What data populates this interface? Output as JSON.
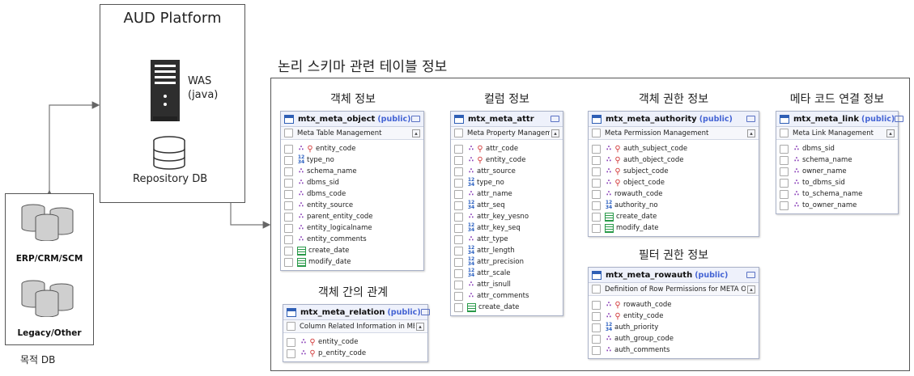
{
  "aud_platform": {
    "title": "AUD Platform",
    "was_label": "WAS\n(java)",
    "repository_label": "Repository DB"
  },
  "target_db": {
    "erp_label": "ERP/CRM/SCM",
    "legacy_label": "Legacy/Other",
    "caption": "목적 DB"
  },
  "main_title": "논리 스키마 관련 테이블 정보",
  "sections": {
    "object": "객체 정보",
    "column": "컬럼 정보",
    "authority": "객체 권한 정보",
    "link": "메타 코드 연결 정보",
    "relation": "객체 간의 관계",
    "filter": "필터 권한 정보"
  },
  "tables": {
    "object": {
      "name": "mtx_meta_object",
      "schema": "(public)",
      "comment": "Meta Table Management",
      "columns": [
        {
          "name": "entity_code",
          "icons": [
            "rel",
            "key"
          ]
        },
        {
          "name": "type_no",
          "icons": [
            "num"
          ]
        },
        {
          "name": "schema_name",
          "icons": [
            "rel"
          ]
        },
        {
          "name": "dbms_sid",
          "icons": [
            "rel"
          ]
        },
        {
          "name": "dbms_code",
          "icons": [
            "rel"
          ]
        },
        {
          "name": "entity_source",
          "icons": [
            "rel"
          ]
        },
        {
          "name": "parent_entity_code",
          "icons": [
            "rel"
          ]
        },
        {
          "name": "entity_logicalname",
          "icons": [
            "rel"
          ]
        },
        {
          "name": "entity_comments",
          "icons": [
            "rel"
          ]
        },
        {
          "name": "create_date",
          "icons": [
            "date"
          ]
        },
        {
          "name": "modify_date",
          "icons": [
            "date"
          ]
        }
      ]
    },
    "attr": {
      "name": "mtx_meta_attr",
      "schema": "",
      "comment": "Meta Property Managemen",
      "columns": [
        {
          "name": "attr_code",
          "icons": [
            "rel",
            "key"
          ]
        },
        {
          "name": "entity_code",
          "icons": [
            "rel",
            "key"
          ]
        },
        {
          "name": "attr_source",
          "icons": [
            "rel"
          ]
        },
        {
          "name": "type_no",
          "icons": [
            "num"
          ]
        },
        {
          "name": "attr_name",
          "icons": [
            "rel"
          ]
        },
        {
          "name": "attr_seq",
          "icons": [
            "num"
          ]
        },
        {
          "name": "attr_key_yesno",
          "icons": [
            "rel"
          ]
        },
        {
          "name": "attr_key_seq",
          "icons": [
            "num"
          ]
        },
        {
          "name": "attr_type",
          "icons": [
            "rel"
          ]
        },
        {
          "name": "attr_length",
          "icons": [
            "num"
          ]
        },
        {
          "name": "attr_precision",
          "icons": [
            "num"
          ]
        },
        {
          "name": "attr_scale",
          "icons": [
            "num"
          ]
        },
        {
          "name": "attr_isnull",
          "icons": [
            "rel"
          ]
        },
        {
          "name": "attr_comments",
          "icons": [
            "rel"
          ]
        },
        {
          "name": "create_date",
          "icons": [
            "date"
          ]
        }
      ]
    },
    "authority": {
      "name": "mtx_meta_authority",
      "schema": "(public)",
      "comment": "Meta Permission Management",
      "columns": [
        {
          "name": "auth_subject_code",
          "icons": [
            "rel",
            "key"
          ]
        },
        {
          "name": "auth_object_code",
          "icons": [
            "rel",
            "key"
          ]
        },
        {
          "name": "subject_code",
          "icons": [
            "rel",
            "key"
          ]
        },
        {
          "name": "object_code",
          "icons": [
            "rel",
            "key"
          ]
        },
        {
          "name": "rowauth_code",
          "icons": [
            "rel"
          ]
        },
        {
          "name": "authority_no",
          "icons": [
            "num"
          ]
        },
        {
          "name": "create_date",
          "icons": [
            "date"
          ]
        },
        {
          "name": "modify_date",
          "icons": [
            "date"
          ]
        }
      ]
    },
    "link": {
      "name": "mtx_meta_link",
      "schema": "(public)",
      "comment": "Meta Link Management",
      "columns": [
        {
          "name": "dbms_sid",
          "icons": [
            "rel"
          ]
        },
        {
          "name": "schema_name",
          "icons": [
            "rel"
          ]
        },
        {
          "name": "owner_name",
          "icons": [
            "rel"
          ]
        },
        {
          "name": "to_dbms_sid",
          "icons": [
            "rel"
          ]
        },
        {
          "name": "to_schema_name",
          "icons": [
            "rel"
          ]
        },
        {
          "name": "to_owner_name",
          "icons": [
            "rel"
          ]
        }
      ]
    },
    "relation": {
      "name": "mtx_meta_relation",
      "schema": "(public)",
      "comment": "Column Related Information in META",
      "columns": [
        {
          "name": "entity_code",
          "icons": [
            "rel",
            "key"
          ]
        },
        {
          "name": "p_entity_code",
          "icons": [
            "rel",
            "key"
          ]
        }
      ]
    },
    "rowauth": {
      "name": "mtx_meta_rowauth",
      "schema": "(public)",
      "comment": "Definition of Row Permissions for META Object",
      "columns": [
        {
          "name": "rowauth_code",
          "icons": [
            "rel",
            "key"
          ]
        },
        {
          "name": "entity_code",
          "icons": [
            "rel",
            "key"
          ]
        },
        {
          "name": "auth_priority",
          "icons": [
            "num"
          ]
        },
        {
          "name": "auth_group_code",
          "icons": [
            "rel"
          ]
        },
        {
          "name": "auth_comments",
          "icons": [
            "rel"
          ]
        }
      ]
    }
  },
  "colors": {
    "table_border": "#a9b1c7",
    "table_header": "#eef1fb",
    "schema_text": "#4464d4",
    "key_icon": "#d23a3a",
    "rel_icon": "#8a3fb8",
    "num_icon": "#2a5fc0",
    "date_icon": "#2a9a4a"
  }
}
